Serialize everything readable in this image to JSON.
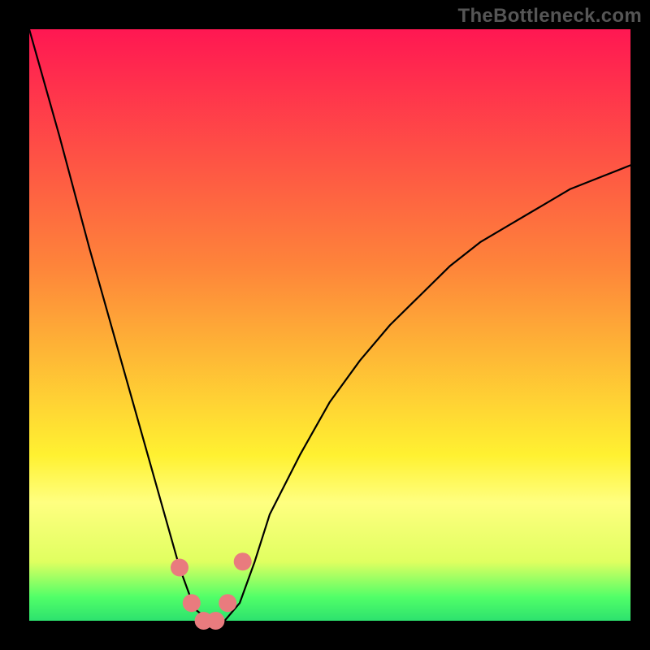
{
  "watermark": "TheBottleneck.com",
  "chart_data": {
    "type": "line",
    "title": "",
    "xlabel": "",
    "ylabel": "",
    "xlim": [
      0,
      100
    ],
    "ylim": [
      0,
      100
    ],
    "x": [
      0,
      5,
      10,
      15,
      20,
      22.5,
      25,
      27.5,
      30,
      32.5,
      35,
      37.5,
      40,
      45,
      50,
      55,
      60,
      65,
      70,
      75,
      80,
      85,
      90,
      95,
      100
    ],
    "values": [
      100,
      82,
      63,
      45,
      27,
      18,
      9,
      2,
      0,
      0,
      3,
      10,
      18,
      28,
      37,
      44,
      50,
      55,
      60,
      64,
      67,
      70,
      73,
      75,
      77
    ],
    "background_gradient_stops": [
      {
        "offset": 0.0,
        "color": "#ff1752"
      },
      {
        "offset": 0.4,
        "color": "#fe843a"
      },
      {
        "offset": 0.72,
        "color": "#fff131"
      },
      {
        "offset": 0.8,
        "color": "#ffff80"
      },
      {
        "offset": 0.9,
        "color": "#e0ff60"
      },
      {
        "offset": 0.96,
        "color": "#51ff68"
      },
      {
        "offset": 1.0,
        "color": "#2DE26E"
      }
    ],
    "annotations": [
      {
        "x": 25.0,
        "y": 9,
        "color": "#e97b7e",
        "r": 11
      },
      {
        "x": 27.0,
        "y": 3,
        "color": "#e97b7e",
        "r": 11
      },
      {
        "x": 29.0,
        "y": 0,
        "color": "#e97b7e",
        "r": 11
      },
      {
        "x": 31.0,
        "y": 0,
        "color": "#e97b7e",
        "r": 11
      },
      {
        "x": 33.0,
        "y": 3,
        "color": "#e97b7e",
        "r": 11
      },
      {
        "x": 35.5,
        "y": 10,
        "color": "#e97b7e",
        "r": 11
      }
    ],
    "frame": {
      "margin_top": 36,
      "margin_right": 24,
      "margin_bottom": 36,
      "margin_left": 36,
      "stroke": "#000",
      "stroke_width": 0
    }
  }
}
